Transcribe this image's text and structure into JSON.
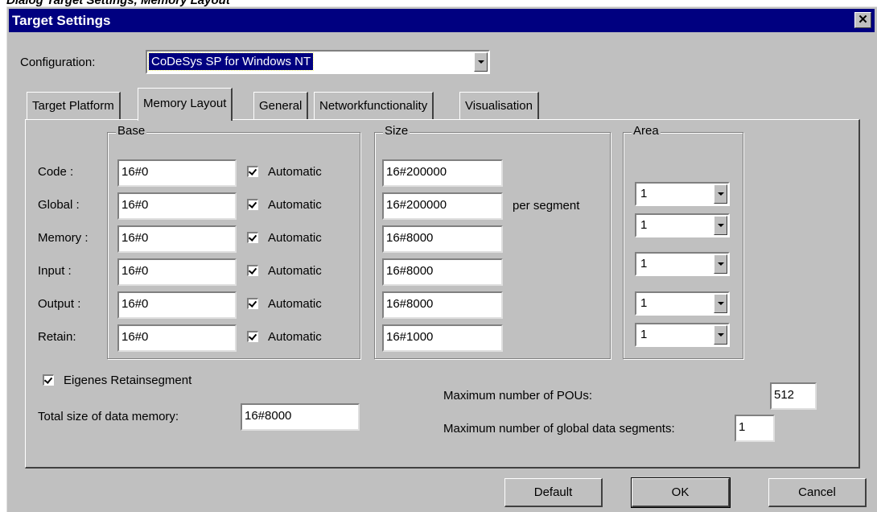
{
  "caption": "Dialog Target Settings, Memory Layout",
  "window": {
    "title": "Target Settings",
    "close_icon": "close-icon"
  },
  "configuration": {
    "label": "Configuration:",
    "value": "CoDeSys SP for Windows NT"
  },
  "tabs": [
    "Target Platform",
    "Memory Layout",
    "General",
    "Networkfunctionality",
    "Visualisation"
  ],
  "active_tab": "Memory Layout",
  "groups": {
    "base": "Base",
    "size": "Size",
    "area": "Area"
  },
  "rows": [
    {
      "label": "Code :",
      "base": "16#0",
      "automatic": "Automatic",
      "size": "16#200000",
      "area": "1"
    },
    {
      "label": "Global :",
      "base": "16#0",
      "automatic": "Automatic",
      "size": "16#200000",
      "area": "1"
    },
    {
      "label": "Memory :",
      "base": "16#0",
      "automatic": "Automatic",
      "size": "16#8000",
      "area": "1"
    },
    {
      "label": "Input :",
      "base": "16#0",
      "automatic": "Automatic",
      "size": "16#8000",
      "area": "1"
    },
    {
      "label": "Output :",
      "base": "16#0",
      "automatic": "Automatic",
      "size": "16#8000",
      "area": "1"
    },
    {
      "label": "Retain:",
      "base": "16#0",
      "automatic": "Automatic",
      "size": "16#1000",
      "area": "1"
    }
  ],
  "per_segment": "per segment",
  "eigenes_retainsegment": {
    "label": "Eigenes Retainsegment",
    "checked": true
  },
  "total_size": {
    "label": "Total size of data memory:",
    "value": "16#8000"
  },
  "max_pous": {
    "label": "Maximum number of POUs:",
    "value": "512"
  },
  "max_global_segments": {
    "label": "Maximum number of global data segments:",
    "value": "1"
  },
  "buttons": {
    "default": "Default",
    "ok": "OK",
    "cancel": "Cancel"
  }
}
